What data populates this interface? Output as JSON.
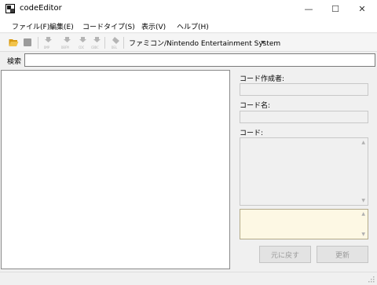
{
  "window": {
    "title": "codeEditor",
    "minimize_glyph": "—",
    "maximize_glyph": "☐",
    "close_glyph": "✕"
  },
  "menu": {
    "file": "ファイル(F)",
    "edit": "編集(E)",
    "code_type": "コードタイプ(S)",
    "view": "表示(V)",
    "help": "ヘルプ(H)"
  },
  "toolbar": {
    "tool1_label": "DMP",
    "tool2_label": "DBFM",
    "tool3_label": "CDC",
    "tool4_label": "CBDC",
    "delete_label": "DEL",
    "platform_selected": "ファミコン/Nintendo Entertainment System"
  },
  "search": {
    "label": "検索",
    "value": ""
  },
  "detail": {
    "author_label": "コード作成者:",
    "author_value": "",
    "name_label": "コード名:",
    "name_value": "",
    "code_label": "コード:",
    "code_value": "",
    "note_value": ""
  },
  "buttons": {
    "revert": "元に戻す",
    "update": "更新"
  },
  "icons": {
    "open": "folder-open-icon",
    "save": "save-icon",
    "delete": "delete-icon"
  },
  "colors": {
    "note_background": "#fdf8e4",
    "folder": "#e0a81c"
  }
}
